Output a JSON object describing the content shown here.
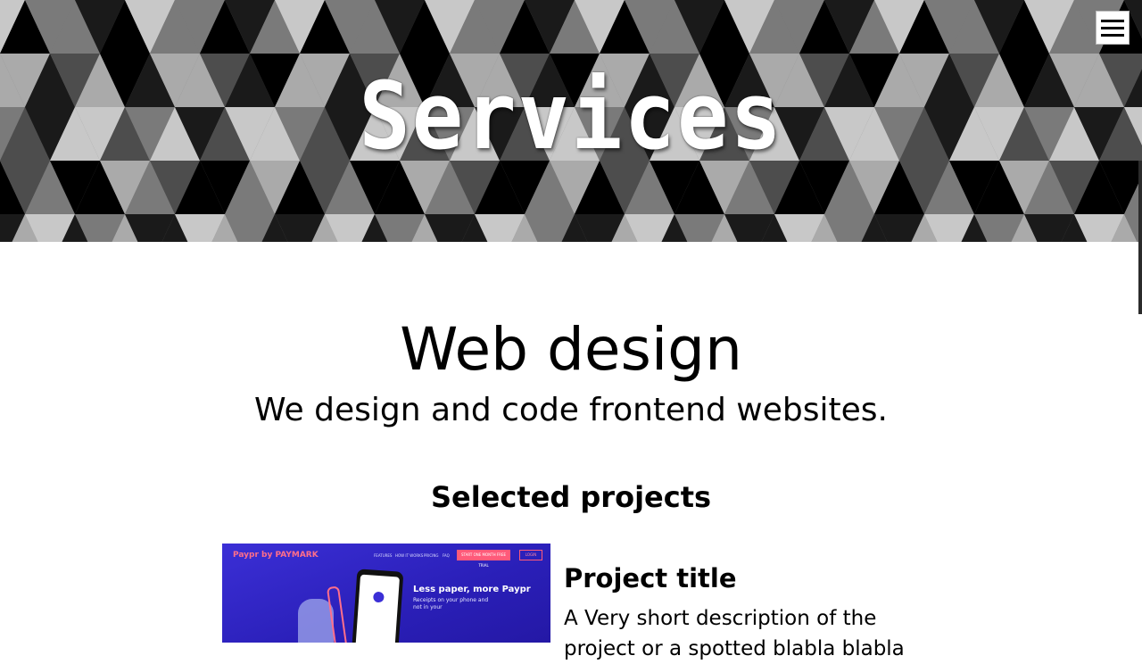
{
  "hero": {
    "title": "Services",
    "pattern_colors": [
      "#000000",
      "#1a1a1a",
      "#4d4d4d",
      "#7a7a7a",
      "#aaaaaa",
      "#c8c8c8"
    ]
  },
  "menu": {
    "icon": "hamburger-menu-icon"
  },
  "section": {
    "title": "Web design",
    "subtitle": "We design and code frontend websites.",
    "projects_heading": "Selected projects"
  },
  "projects": [
    {
      "title": "Project title",
      "description": "A Very short description of the project or a spotted blabla blabla",
      "thumbnail": {
        "brand": "Paypr by PAYMARK",
        "nav": [
          "FEATURES",
          "HOW IT WORKS",
          "PRICING",
          "FAQ"
        ],
        "cta": "START ONE MONTH FREE TRIAL",
        "login": "LOGIN",
        "headline": "Less paper, more Paypr",
        "tagline": "Receipts on your phone and not in your"
      }
    }
  ]
}
